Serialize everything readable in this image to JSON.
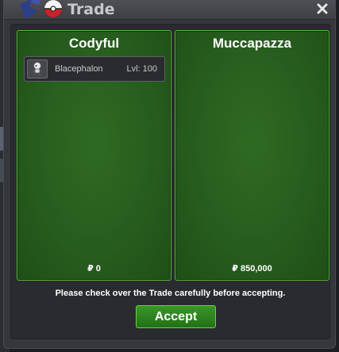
{
  "window": {
    "title": "Trade",
    "logo_icon": "pokeball-logo-icon",
    "close_icon": "close-icon"
  },
  "left_panel": {
    "player": "Codyful",
    "items": [
      {
        "icon": "blacephalon-sprite-icon",
        "name": "Blacephalon",
        "level": "Lvl: 100"
      }
    ],
    "money": "₽ 0"
  },
  "right_panel": {
    "player": "Muccapazza",
    "items": [],
    "money": "₽ 850,000"
  },
  "notice": "Please check over the Trade carefully before accepting.",
  "accept_label": "Accept",
  "colors": {
    "panel_green": "#28601f",
    "panel_border": "#56b838",
    "window_bg": "#35373b",
    "accept_green": "#2f8a22"
  }
}
